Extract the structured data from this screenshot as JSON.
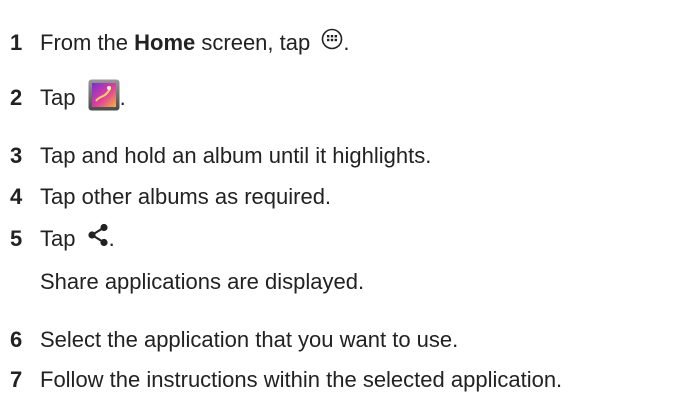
{
  "steps": [
    {
      "num": "1",
      "pre": "From the ",
      "bold": "Home",
      "post": " screen, tap ",
      "end": ".",
      "icon": "apps-grid-icon"
    },
    {
      "num": "2",
      "pre": "Tap ",
      "end": ".",
      "icon": "gallery-app-icon"
    },
    {
      "num": "3",
      "text": "Tap and hold an album until it highlights."
    },
    {
      "num": "4",
      "text": "Tap other albums as required."
    },
    {
      "num": "5",
      "pre": "Tap ",
      "end": ".",
      "icon": "share-icon",
      "note": "Share applications are displayed."
    },
    {
      "num": "6",
      "text": "Select the application that you want to use."
    },
    {
      "num": "7",
      "text": "Follow the instructions within the selected application."
    }
  ],
  "colors": {
    "text": "#222222",
    "gallery_gradient": [
      "#7a2fd0",
      "#e0409a",
      "#f4b23a"
    ]
  }
}
